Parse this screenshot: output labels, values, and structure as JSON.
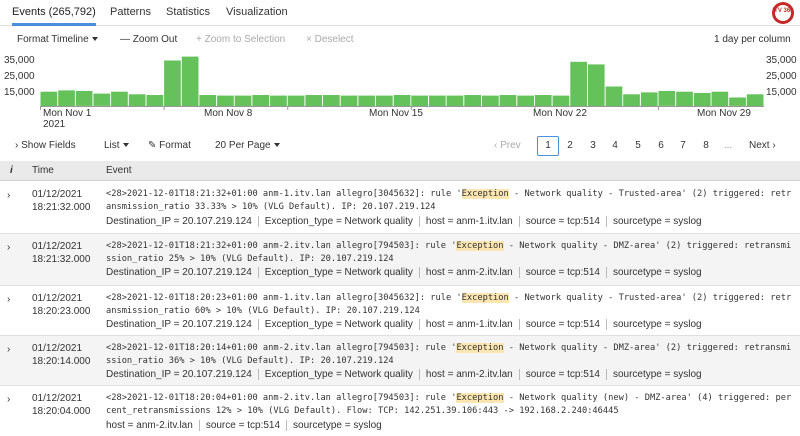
{
  "tabs": [
    {
      "label": "Events (265,792)"
    },
    {
      "label": "Patterns"
    },
    {
      "label": "Statistics"
    },
    {
      "label": "Visualization"
    }
  ],
  "logo_text": "ITV 360",
  "toolbar": {
    "format_timeline": "Format Timeline",
    "zoom_out": "— Zoom Out",
    "zoom_selection": "+ Zoom to Selection",
    "deselect": "× Deselect",
    "scale": "1 day per column"
  },
  "chart_data": {
    "type": "bar",
    "y_ticks": [
      "35,000",
      "25,000",
      "15,000"
    ],
    "x_labels": [
      "Mon Nov 1\n2021",
      "Mon Nov 8",
      "Mon Nov 15",
      "Mon Nov 22",
      "Mon Nov 29"
    ],
    "values": [
      11000,
      12000,
      11500,
      9500,
      11000,
      9000,
      8500,
      35000,
      38000,
      8500,
      8000,
      8000,
      8500,
      8000,
      8000,
      8500,
      8500,
      8000,
      8000,
      8000,
      8500,
      8000,
      8000,
      8000,
      8500,
      8000,
      8500,
      8000,
      8500,
      8000,
      34000,
      32000,
      15000,
      9000,
      10500,
      11500,
      11000,
      10000,
      11000,
      6500,
      9000
    ],
    "ylim": [
      0,
      40000
    ],
    "color": "#65c15a"
  },
  "controls": {
    "show_fields": "Show Fields",
    "list": "List",
    "format": "Format",
    "per_page": "20 Per Page",
    "prev": "‹ Prev",
    "pages": [
      "1",
      "2",
      "3",
      "4",
      "5",
      "6",
      "7",
      "8",
      "..."
    ],
    "next": "Next ›"
  },
  "table": {
    "col_info": "i",
    "col_time": "Time",
    "col_event": "Event"
  },
  "events": [
    {
      "date": "01/12/2021",
      "time": "18:21:32.000",
      "raw_pre": "<28>2021-12-01T18:21:32+01:00 anm-1.itv.lan allegro[3045632]: rule '",
      "raw_hl": "Exception",
      "raw_post": " - Network quality - Trusted-area' (2) triggered: retransmission_ratio 33.33% > 10% (VLG Default). IP: 20.107.219.124",
      "fields": [
        "Destination_IP = 20.107.219.124",
        "Exception_type = Network quality",
        "host = anm-1.itv.lan",
        "source = tcp:514",
        "sourcetype = syslog"
      ]
    },
    {
      "date": "01/12/2021",
      "time": "18:21:32.000",
      "raw_pre": "<28>2021-12-01T18:21:32+01:00 anm-2.itv.lan allegro[794503]: rule '",
      "raw_hl": "Exception",
      "raw_post": " - Network quality - DMZ-area' (2) triggered: retransmission_ratio 25% > 10% (VLG Default). IP: 20.107.219.124",
      "fields": [
        "Destination_IP = 20.107.219.124",
        "Exception_type = Network quality",
        "host = anm-2.itv.lan",
        "source = tcp:514",
        "sourcetype = syslog"
      ]
    },
    {
      "date": "01/12/2021",
      "time": "18:20:23.000",
      "raw_pre": "<28>2021-12-01T18:20:23+01:00 anm-1.itv.lan allegro[3045632]: rule '",
      "raw_hl": "Exception",
      "raw_post": " - Network quality - Trusted-area' (2) triggered: retransmission_ratio 60% > 10% (VLG Default). IP: 20.107.219.124",
      "fields": [
        "Destination_IP = 20.107.219.124",
        "Exception_type = Network quality",
        "host = anm-1.itv.lan",
        "source = tcp:514",
        "sourcetype = syslog"
      ]
    },
    {
      "date": "01/12/2021",
      "time": "18:20:14.000",
      "raw_pre": "<28>2021-12-01T18:20:14+01:00 anm-2.itv.lan allegro[794503]: rule '",
      "raw_hl": "Exception",
      "raw_post": " - Network quality - DMZ-area' (2) triggered: retransmission_ratio 36% > 10% (VLG Default). IP: 20.107.219.124",
      "fields": [
        "Destination_IP = 20.107.219.124",
        "Exception_type = Network quality",
        "host = anm-2.itv.lan",
        "source = tcp:514",
        "sourcetype = syslog"
      ]
    },
    {
      "date": "01/12/2021",
      "time": "18:20:04.000",
      "raw_pre": "<28>2021-12-01T18:20:04+01:00 anm-2.itv.lan allegro[794503]: rule '",
      "raw_hl": "Exception",
      "raw_post": " - Network quality (new) - DMZ-area' (4) triggered: percent_retransmissions 12% > 10% (VLG Default). Flow: TCP: 142.251.39.106:443 -> 192.168.2.240:46445",
      "fields": [
        "host = anm-2.itv.lan",
        "source = tcp:514",
        "sourcetype = syslog"
      ]
    }
  ]
}
